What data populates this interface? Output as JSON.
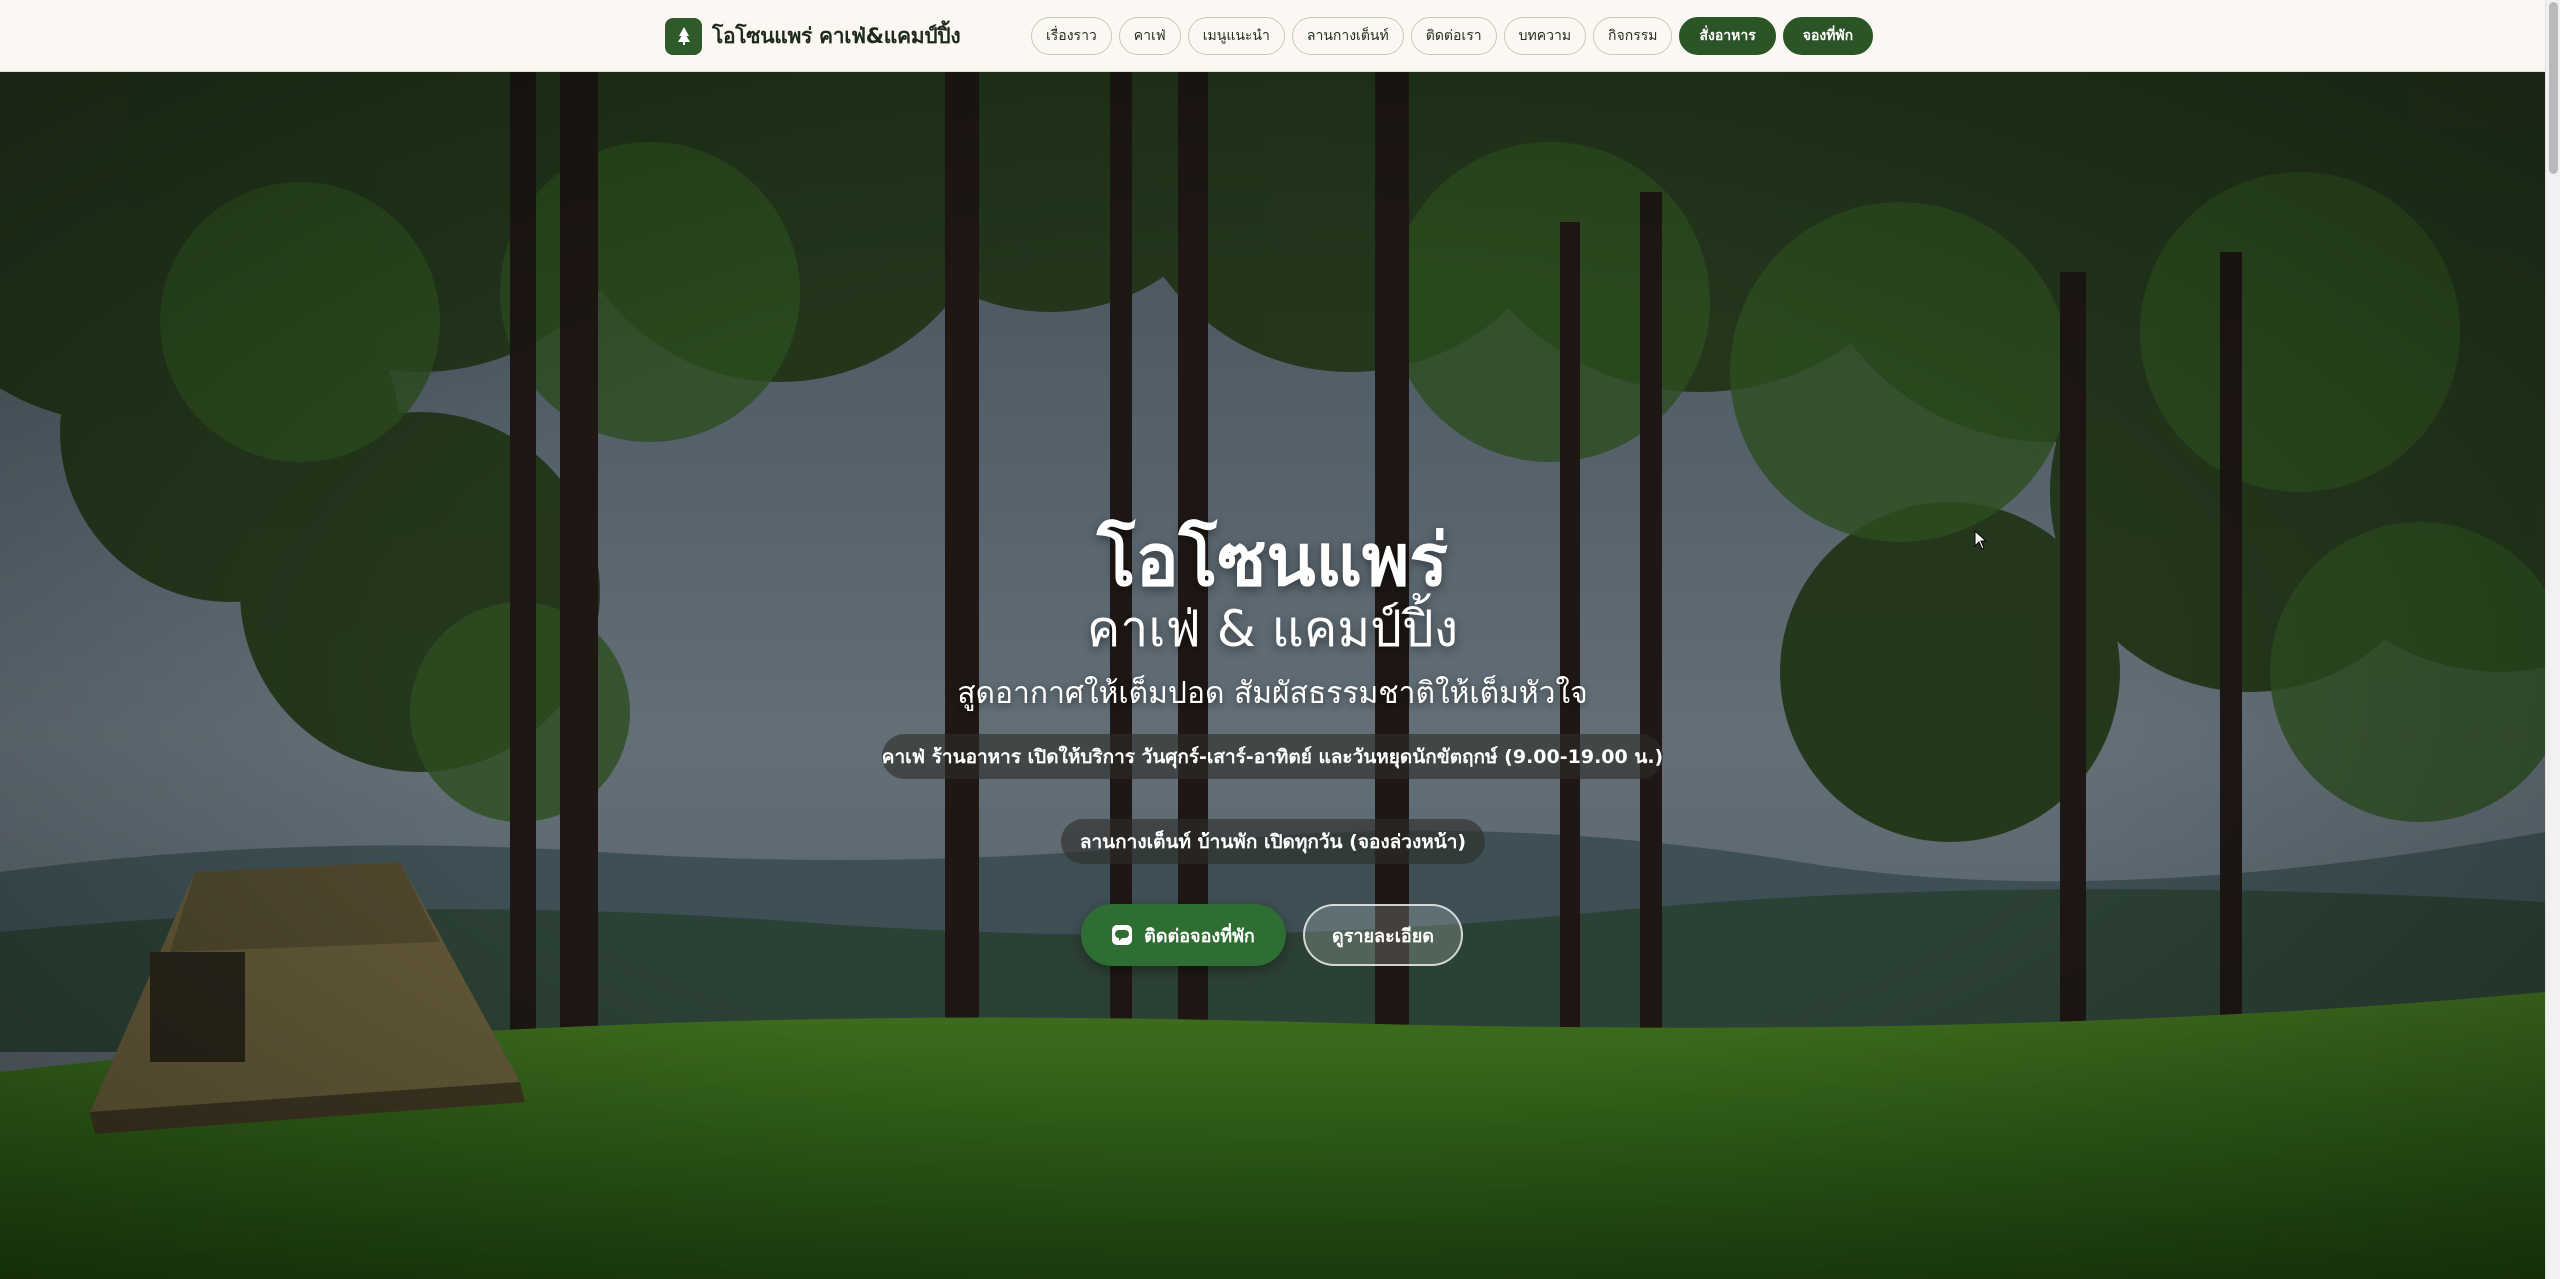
{
  "header": {
    "brand": "โอโซนแพร่ คาเฟ่&แคมป์ปิ้ง",
    "brand_icon": "tree-icon",
    "nav": [
      {
        "label": "เรื่องราว"
      },
      {
        "label": "คาเฟ่"
      },
      {
        "label": "เมนูแนะนำ"
      },
      {
        "label": "ลานกางเต็นท์"
      },
      {
        "label": "ติดต่อเรา"
      },
      {
        "label": "บทความ"
      },
      {
        "label": "กิจกรรม"
      }
    ],
    "order_label": "สั่งอาหาร",
    "book_label": "จองที่พัก"
  },
  "hero": {
    "title": "โอโซนแพร่",
    "subtitle": "คาเฟ่ & แคมป์ปิ้ง",
    "tagline": "สูดอากาศให้เต็มปอด สัมผัสธรรมชาติให้เต็มหัวใจ",
    "hours_cafe": "คาเฟ่ ร้านอาหาร เปิดให้บริการ วันศุกร์-เสาร์-อาทิตย์ และวันหยุดนักขัตฤกษ์ (9.00-19.00 น.)",
    "hours_camp": "ลานกางเต็นท์ บ้านพัก เปิดทุกวัน (จองล่วงหน้า)",
    "cta_book": "ติดต่อจองที่พัก",
    "cta_book_icon": "line-chat-icon",
    "cta_detail": "ดูรายละเอียด"
  },
  "colors": {
    "brand_green": "#2b5427",
    "cta_green": "#2f6e33",
    "header_bg": "#fbf8f4"
  }
}
